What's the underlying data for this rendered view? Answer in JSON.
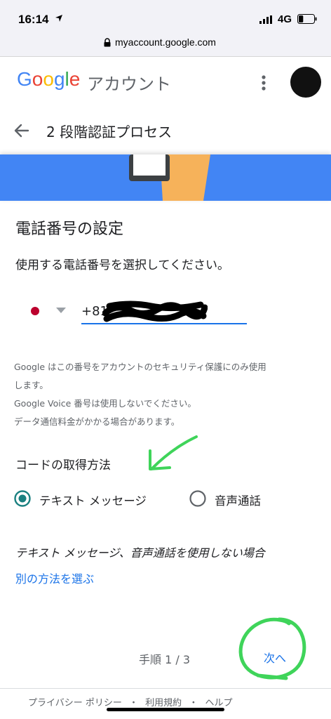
{
  "status_bar": {
    "time": "16:14",
    "network": "4G",
    "battery_level": 0.3
  },
  "browser": {
    "url": "myaccount.google.com"
  },
  "header": {
    "logo_letters": [
      {
        "char": "G",
        "color": "#4285f4"
      },
      {
        "char": "o",
        "color": "#ea4335"
      },
      {
        "char": "o",
        "color": "#fbbc05"
      },
      {
        "char": "g",
        "color": "#4285f4"
      },
      {
        "char": "l",
        "color": "#34a853"
      },
      {
        "char": "e",
        "color": "#ea4335"
      }
    ],
    "logo_suffix": "アカウント"
  },
  "page": {
    "title": "2 段階認証プロセス",
    "heading": "電話番号の設定",
    "instruction": "使用する電話番号を選択してください。",
    "phone_value": "+81",
    "notes": [
      "Google はこの番号をアカウントのセキュリティ保護にのみ使用",
      "します。",
      "Google Voice 番号は使用しないでください。",
      "データ通信料金がかかる場合があります。"
    ],
    "code_method_heading": "コードの取得方法",
    "options": [
      {
        "label": "テキスト メッセージ",
        "selected": true
      },
      {
        "label": "音声通話",
        "selected": false
      }
    ],
    "alt_text": "テキスト メッセージ、音声通話を使用しない場合",
    "alt_link": "別の方法を選ぶ",
    "step": "手順 1 / 3",
    "next": "次へ"
  },
  "footer": {
    "links": [
      "プライバシー ポリシー",
      "・",
      "利用規約",
      "・",
      "ヘルプ"
    ]
  },
  "colors": {
    "accent": "#1a73e8",
    "radio_teal": "#1a8080",
    "hero": "#4285f4",
    "annotation_green": "#3fd45a"
  }
}
